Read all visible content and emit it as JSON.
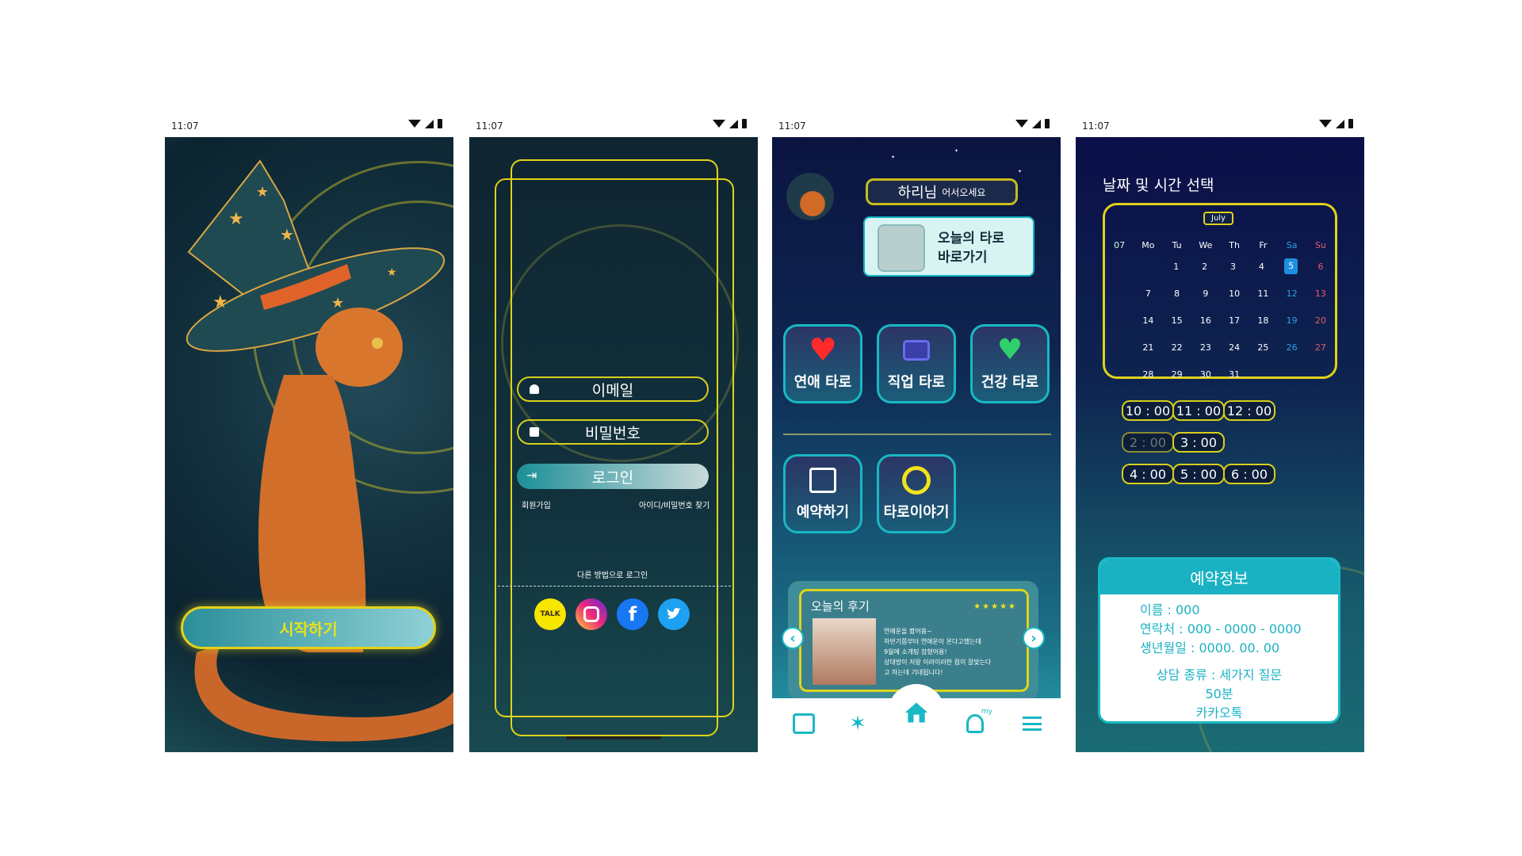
{
  "status_time": "11:07",
  "screen1": {
    "start_label": "시작하기"
  },
  "screen2": {
    "email_label": "이메일",
    "password_label": "비밀번호",
    "login_label": "로그인",
    "signup_label": "회원가입",
    "find_label": "아이디/비밀번호 찾기",
    "other_login_label": "다른 방법으로 로그인",
    "social": [
      {
        "name": "kakaotalk",
        "text": "TALK",
        "color": "#f7e600"
      },
      {
        "name": "instagram",
        "text": "",
        "color": "#d6249f"
      },
      {
        "name": "facebook",
        "text": "f",
        "color": "#1877f2"
      },
      {
        "name": "twitter",
        "text": "",
        "color": "#1da1f2"
      }
    ]
  },
  "screen3": {
    "greeting_name": "하리님",
    "greeting_text": "어서오세요",
    "note_line1": "오늘의 타로",
    "note_line2": "바로가기",
    "tiles": [
      "연애 타로",
      "직업 타로",
      "건강 타로",
      "예약하기",
      "타로이야기"
    ],
    "review_title": "오늘의 후기",
    "review_stars": "★★★★★",
    "review_lines": [
      "연애운을 봤어용~",
      "하반기쯤부터 연애운이 온다고했는데",
      "9월에 소개팅 잡혔어용!",
      "상대방이 저랑 이러이러한 점이 잘맞는다",
      "고 하는데 기대됩니다!"
    ],
    "nav_my": "my"
  },
  "screen4": {
    "title": "날짜 및 시간 선택",
    "month": "July",
    "month_num": "07",
    "weekdays": [
      "Mo",
      "Tu",
      "We",
      "Th",
      "Fr",
      "Sa",
      "Su"
    ],
    "weeks": [
      [
        "",
        "1",
        "2",
        "3",
        "4",
        "5",
        "6"
      ],
      [
        "7",
        "8",
        "9",
        "10",
        "11",
        "12",
        "13"
      ],
      [
        "14",
        "15",
        "16",
        "17",
        "18",
        "19",
        "20"
      ],
      [
        "21",
        "22",
        "23",
        "24",
        "25",
        "26",
        "27"
      ],
      [
        "28",
        "29",
        "30",
        "31",
        "",
        "",
        ""
      ]
    ],
    "selected_day": "5",
    "times": [
      "10 : 00",
      "11 : 00",
      "12 : 00",
      "2 : 00",
      "3 : 00",
      "4 : 00",
      "5 : 00",
      "6 : 00"
    ],
    "info_title": "예약정보",
    "info_name": "이름 :  000",
    "info_contact": "연락처 : 000 - 0000 - 0000",
    "info_birth": "생년월일 : 0000. 00. 00",
    "info_type": "상담 종류 : 세가지 질문",
    "info_duration": "50분",
    "info_channel": "카카오톡"
  }
}
